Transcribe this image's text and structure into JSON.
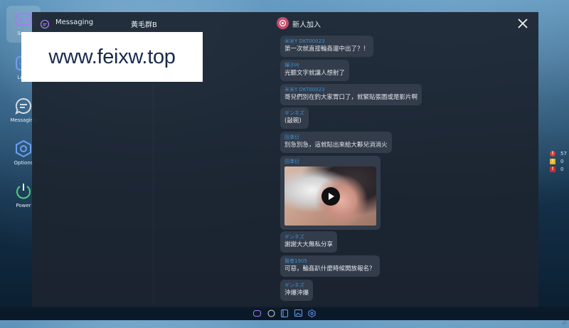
{
  "sidebar": {
    "items": [
      {
        "label": "Save",
        "icon": "gamepad-icon"
      },
      {
        "label": "Load",
        "icon": "load-icon"
      },
      {
        "label": "Messaging",
        "icon": "message-icon"
      },
      {
        "label": "Options",
        "icon": "gear-icon"
      },
      {
        "label": "Power",
        "icon": "power-icon"
      }
    ]
  },
  "watermark": {
    "text": "www.feixw.top"
  },
  "header": {
    "title": "Messaging",
    "group": "黃毛群B",
    "room": "新人加入"
  },
  "messages": [
    {
      "name": "米米Y DKT00023",
      "text": "第一次就直接輪姦還中出了？！"
    },
    {
      "name": "樺子吟",
      "text": "光聽文字就讓人想射了"
    },
    {
      "name": "米米Y DKT00023",
      "text": "哥兒們別在釣大家胃口了，就緊貼張圖或是影片啊"
    },
    {
      "name": "ギンネズ",
      "text": "(敲碗)"
    },
    {
      "name": "田凖衍",
      "text": "別急別急，這就貼出來給大夥兒消消火"
    },
    {
      "name": "田凖衍",
      "media": "video"
    },
    {
      "name": "ギンネズ",
      "text": "謝謝大大無私分享"
    },
    {
      "name": "賢者1905",
      "text": "可惡，輪姦趴什麼時候開放報名？"
    },
    {
      "name": "ギンネズ",
      "text": "沖爆沖爆"
    }
  ],
  "status": [
    {
      "value": "57",
      "color": "#e03a3a",
      "icon": "error-icon"
    },
    {
      "value": "0",
      "color": "#e8b820",
      "icon": "warning-icon"
    },
    {
      "value": "0",
      "color": "#c83030",
      "icon": "alert-icon"
    }
  ],
  "colors": {
    "accent": "#3d8fd1",
    "window": "#1c2430",
    "bubble": "#323c4b"
  }
}
